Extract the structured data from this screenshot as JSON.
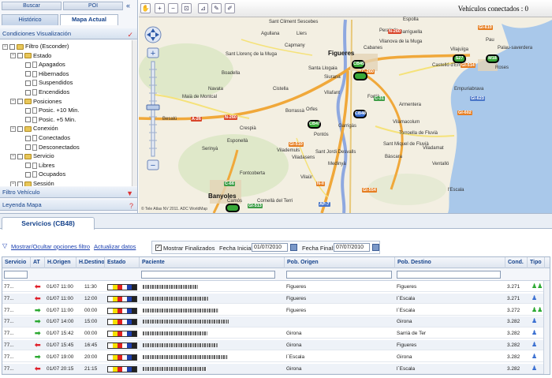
{
  "left_panel": {
    "buscar": "Buscar",
    "poi": "POI",
    "collapse": "«",
    "tab_historico": "Histórico",
    "tab_mapa": "Mapa Actual",
    "cond_header": "Condiciones Visualización",
    "filtro_vehiculo": "Filtro Vehículo",
    "leyenda_mapa": "Leyenda Mapa",
    "tree": [
      {
        "label": "Filtro (Esconder)",
        "level": 0,
        "kind": "folder",
        "exp": "−"
      },
      {
        "label": "Estado",
        "level": 1,
        "kind": "folder",
        "exp": "−"
      },
      {
        "label": "Apagados",
        "level": 2,
        "kind": "doc"
      },
      {
        "label": "Hibernados",
        "level": 2,
        "kind": "doc"
      },
      {
        "label": "Suspendidos",
        "level": 2,
        "kind": "doc"
      },
      {
        "label": "Encendidos",
        "level": 2,
        "kind": "doc"
      },
      {
        "label": "Posiciones",
        "level": 1,
        "kind": "folder",
        "exp": "−"
      },
      {
        "label": "Posic. +10 Min.",
        "level": 2,
        "kind": "doc"
      },
      {
        "label": "Posic. +5 Min.",
        "level": 2,
        "kind": "doc"
      },
      {
        "label": "Conexión",
        "level": 1,
        "kind": "folder",
        "exp": "−"
      },
      {
        "label": "Conectados",
        "level": 2,
        "kind": "doc"
      },
      {
        "label": "Desconectados",
        "level": 2,
        "kind": "doc"
      },
      {
        "label": "Servicio",
        "level": 1,
        "kind": "folder",
        "exp": "−"
      },
      {
        "label": "Libres",
        "level": 2,
        "kind": "doc"
      },
      {
        "label": "Ocupados",
        "level": 2,
        "kind": "doc"
      },
      {
        "label": "Sessión",
        "level": 1,
        "kind": "folder",
        "exp": "−"
      }
    ]
  },
  "map": {
    "vehicles_connected": "Vehículos conectados : 0",
    "copyright": "© Tele Atlas NV 2011. ADC WorldMap",
    "towns": [
      {
        "name": "Figueres",
        "big": true
      },
      {
        "name": "Roses",
        "big": false
      },
      {
        "name": "Besalú",
        "big": false
      },
      {
        "name": "Banyoles",
        "big": true
      },
      {
        "name": "Vilafant",
        "big": false
      },
      {
        "name": "Garrigàs",
        "big": false
      },
      {
        "name": "Pontós",
        "big": false
      },
      {
        "name": "Vilamacolum",
        "big": false
      },
      {
        "name": "Torroella de Fluvià",
        "big": false
      },
      {
        "name": "Sant Miquel de Fluvià",
        "big": false
      },
      {
        "name": "Bàscara",
        "big": false
      },
      {
        "name": "Viladamat",
        "big": false
      },
      {
        "name": "Ventalló",
        "big": false
      },
      {
        "name": "l'Escala",
        "big": false
      },
      {
        "name": "Vilajuïga",
        "big": false
      },
      {
        "name": "Castelló d'Empúries",
        "big": false
      },
      {
        "name": "Llers",
        "big": false
      },
      {
        "name": "Sant Climent Sescebes",
        "big": false
      },
      {
        "name": "Esponellà",
        "big": false
      },
      {
        "name": "Serinyà",
        "big": false
      },
      {
        "name": "Crespià",
        "big": false
      },
      {
        "name": "Espolla",
        "big": false
      },
      {
        "name": "Empuriabrava",
        "big": false
      },
      {
        "name": "Vilanova de la Muga",
        "big": false
      },
      {
        "name": "Pau",
        "big": false
      },
      {
        "name": "Palau-saverdera",
        "big": false
      },
      {
        "name": "Navata",
        "big": false
      },
      {
        "name": "Cistella",
        "big": false
      },
      {
        "name": "Orfes",
        "big": false
      },
      {
        "name": "Fontcoberta",
        "big": false
      },
      {
        "name": "Camós",
        "big": false
      },
      {
        "name": "Cornellà del Terri",
        "big": false
      },
      {
        "name": "Medinyà",
        "big": false
      },
      {
        "name": "Sant Jordi Desvalls",
        "big": false
      },
      {
        "name": "Viladasens",
        "big": false
      },
      {
        "name": "Vilaür",
        "big": false
      },
      {
        "name": "Maià de Montcal",
        "big": false
      },
      {
        "name": "Sant Llorenç de la Muga",
        "big": false
      },
      {
        "name": "Boadella",
        "big": false
      },
      {
        "name": "Capmany",
        "big": false
      },
      {
        "name": "Agullana",
        "big": false
      },
      {
        "name": "Cabanes",
        "big": false
      },
      {
        "name": "Garriguella",
        "big": false
      },
      {
        "name": "Peralada",
        "big": false
      },
      {
        "name": "Siurana",
        "big": false
      },
      {
        "name": "Fortià",
        "big": false
      },
      {
        "name": "Santa Llogaia",
        "big": false
      },
      {
        "name": "Borrassà",
        "big": false
      },
      {
        "name": "Vilademuls",
        "big": false
      },
      {
        "name": "Armentera",
        "big": false
      }
    ],
    "roads": [
      "N-260",
      "A-26",
      "N-260",
      "C-31",
      "C-66",
      "GI-513",
      "GI-623",
      "N-II",
      "AP-7",
      "GI-510",
      "GI-610",
      "GI-554",
      "C-260",
      "GI-602",
      "GI-514"
    ],
    "vehicles": [
      {
        "label": "CB45",
        "color": "green"
      },
      {
        "label": "",
        "color": "green"
      },
      {
        "label": "CB48",
        "color": "blue"
      },
      {
        "label": "CB47",
        "color": "green"
      },
      {
        "label": "S27",
        "color": "green"
      },
      {
        "label": "M18",
        "color": "green"
      },
      {
        "label": "",
        "color": "green"
      }
    ]
  },
  "bottom": {
    "tab_servicios": "Servicios (CB48)",
    "toggle_filters": "Mostrar/Ocultar opciones filtro",
    "update": "Actualizar datos",
    "show_finished": "Mostrar Finalizados",
    "date_start_label": "Fecha Inicial:",
    "date_start": "01/07/2010",
    "date_end_label": "Fecha Final:",
    "date_end": "07/07/2010",
    "columns": [
      "Servicio",
      "AT",
      "H.Origen",
      "H.Destino",
      "Estado",
      "Paciente",
      "Pob. Origen",
      "Pob. Destino",
      "Cond.",
      "Tipo"
    ],
    "rows": [
      {
        "servicio": "77...",
        "at": "left",
        "horigen": "01/07 11:00",
        "hdestino": "11:30",
        "origen": "Figueres",
        "destino": "Figueres",
        "cond": "3.271",
        "tipo": "green3"
      },
      {
        "servicio": "77...",
        "at": "left",
        "horigen": "01/07 11:00",
        "hdestino": "12:00",
        "origen": "Figueres",
        "destino": "l´Escala",
        "cond": "3.271",
        "tipo": "blue1"
      },
      {
        "servicio": "77...",
        "at": "right",
        "horigen": "01/07 11:00",
        "hdestino": "00:00",
        "origen": "Figueres",
        "destino": "l´Escala",
        "cond": "3.272",
        "tipo": "green3"
      },
      {
        "servicio": "77...",
        "at": "right",
        "horigen": "01/07 14:00",
        "hdestino": "15:00",
        "origen": "",
        "destino": "Girona",
        "cond": "3.282",
        "tipo": "blue1"
      },
      {
        "servicio": "77...",
        "at": "right",
        "horigen": "01/07 15:42",
        "hdestino": "00:00",
        "origen": "Girona",
        "destino": "Sarrià de Ter",
        "cond": "3.282",
        "tipo": "blue1"
      },
      {
        "servicio": "77...",
        "at": "left",
        "horigen": "01/07 15:45",
        "hdestino": "16:45",
        "origen": "Girona",
        "destino": "Figueres",
        "cond": "3.282",
        "tipo": "blue1"
      },
      {
        "servicio": "77...",
        "at": "right",
        "horigen": "01/07 19:00",
        "hdestino": "20:00",
        "origen": "l´Escala",
        "destino": "Girona",
        "cond": "3.282",
        "tipo": "blue1"
      },
      {
        "servicio": "77...",
        "at": "left",
        "horigen": "01/07 20:15",
        "hdestino": "21:15",
        "origen": "Girona",
        "destino": "l´Escala",
        "cond": "3.282",
        "tipo": "blue1"
      }
    ],
    "colors": {
      "arrow_left": "#e0202a",
      "arrow_right": "#2aa830",
      "tipo_green": "#2aa830",
      "tipo_blue": "#3a6fd1",
      "estado_bar": [
        "#ffffff",
        "#f4e100",
        "#e02020",
        "#ffffff",
        "#1f3fb0",
        "#222222"
      ]
    }
  }
}
